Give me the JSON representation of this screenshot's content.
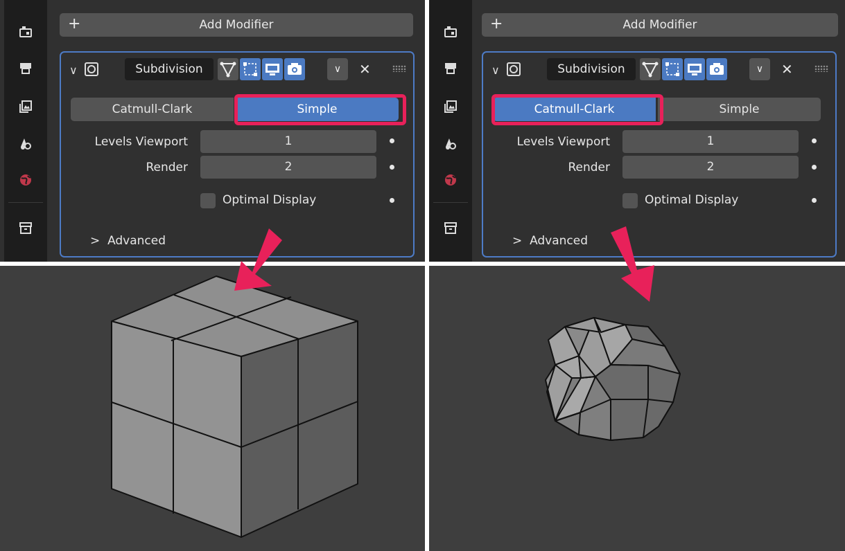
{
  "colors": {
    "accent_blue": "#4b7ac2",
    "highlight": "#e8215a",
    "panel_bg": "#303030",
    "widget_bg": "#545454",
    "viewport_bg": "#3e3e3e"
  },
  "sidebar_icons": [
    "render-properties-icon",
    "output-properties-icon",
    "view-layer-properties-icon",
    "scene-properties-icon",
    "world-properties-icon",
    "collection-properties-icon"
  ],
  "left": {
    "add_modifier": {
      "plus": "+",
      "label": "Add Modifier"
    },
    "modifier": {
      "name": "Subdivision",
      "toggle_catmull": "Catmull-Clark",
      "toggle_simple": "Simple",
      "selected": "Simple",
      "levels_viewport_label": "Levels Viewport",
      "levels_viewport_value": "1",
      "render_label": "Render",
      "render_value": "2",
      "optimal_display_label": "Optimal Display",
      "advanced_label": "Advanced"
    }
  },
  "right": {
    "add_modifier": {
      "plus": "+",
      "label": "Add Modifier"
    },
    "modifier": {
      "name": "Subdivision",
      "toggle_catmull": "Catmull-Clark",
      "toggle_simple": "Simple",
      "selected": "Catmull-Clark",
      "levels_viewport_label": "Levels Viewport",
      "levels_viewport_value": "1",
      "render_label": "Render",
      "render_value": "2",
      "optimal_display_label": "Optimal Display",
      "advanced_label": "Advanced"
    }
  }
}
